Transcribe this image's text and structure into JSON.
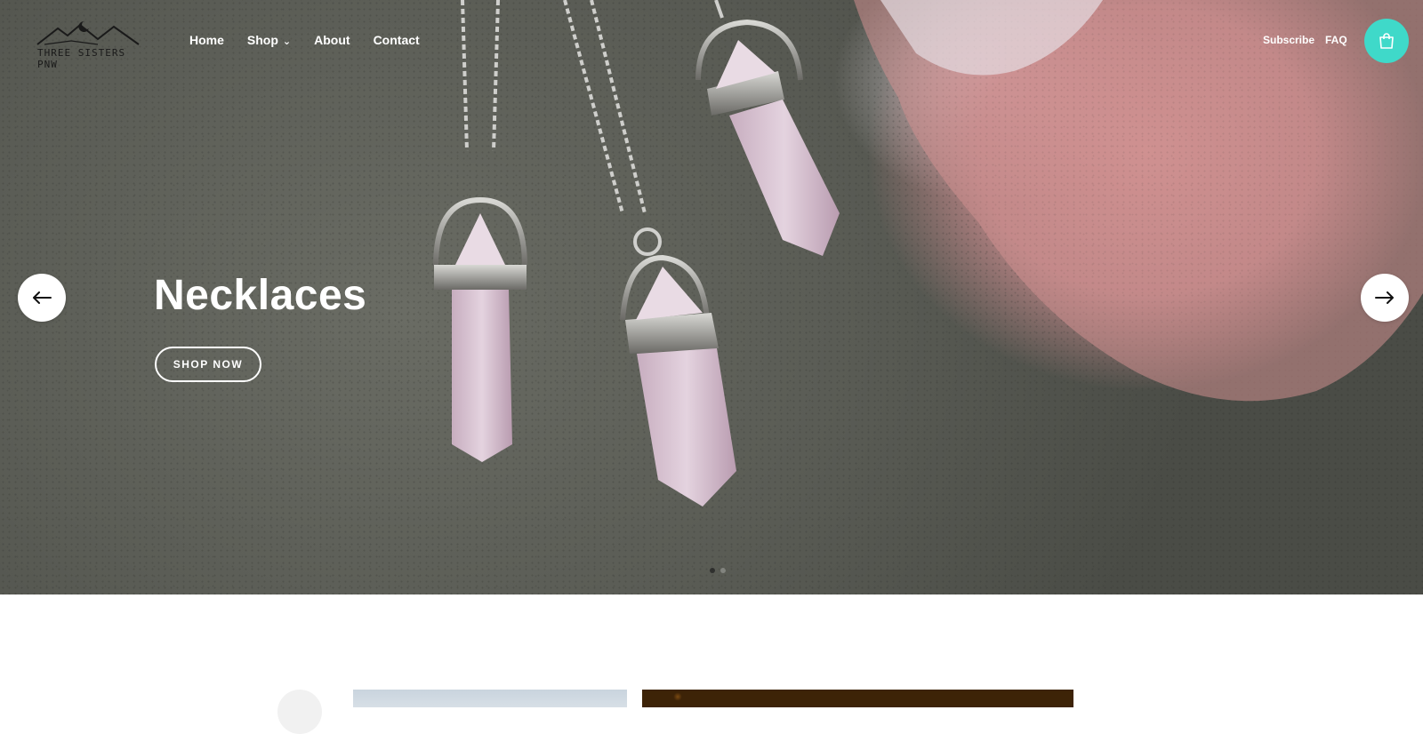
{
  "brand": {
    "name": "THREE SISTERS PNW"
  },
  "nav": {
    "items": [
      {
        "label": "Home"
      },
      {
        "label": "Shop",
        "has_dropdown": true
      },
      {
        "label": "About"
      },
      {
        "label": "Contact"
      }
    ]
  },
  "utility": {
    "subscribe": "Subscribe",
    "faq": "FAQ",
    "cart_icon": "shopping-bag-icon"
  },
  "hero": {
    "title": "Necklaces",
    "cta": "SHOP NOW",
    "prev_icon": "arrow-left-icon",
    "next_icon": "arrow-right-icon",
    "slide_count": 2,
    "active_slide": 1
  },
  "colors": {
    "accent": "#3fd9c9",
    "hero_text": "#ffffff"
  }
}
